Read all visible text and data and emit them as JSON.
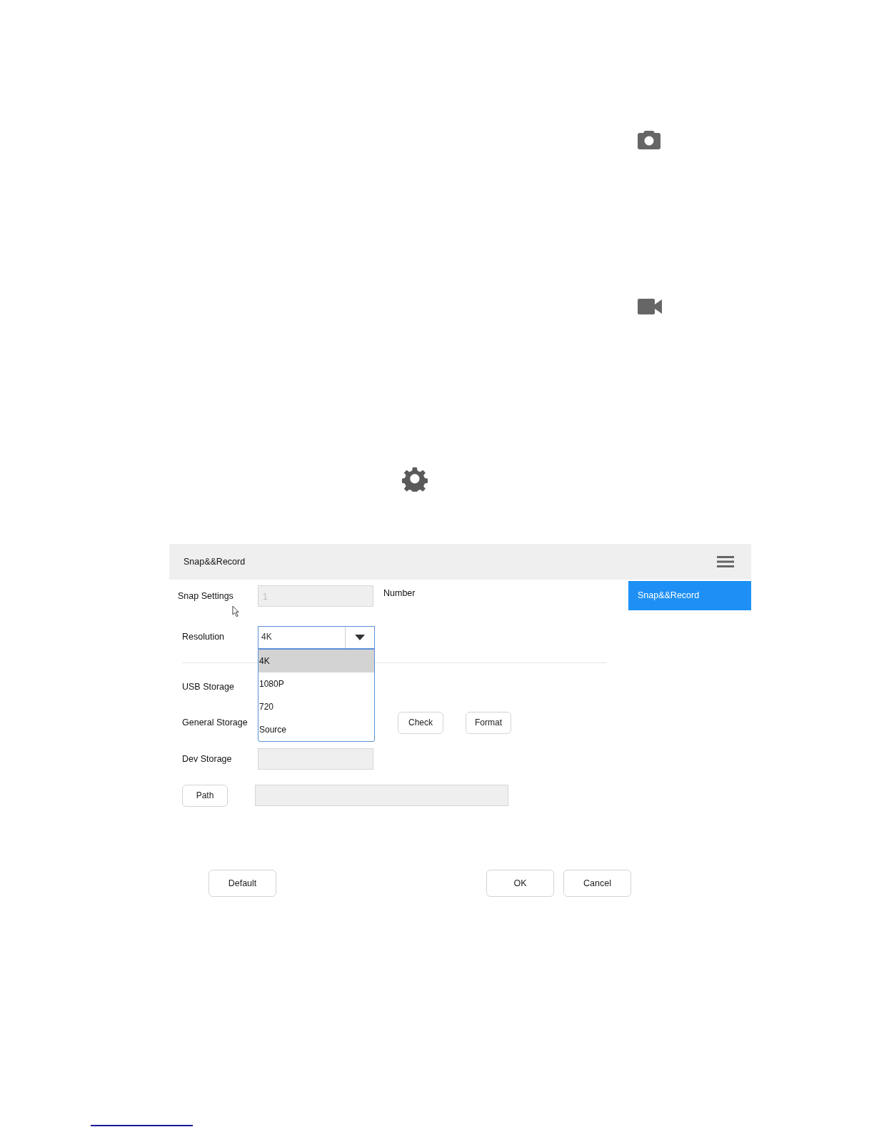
{
  "dialog": {
    "title": "Snap&&Record",
    "menu_items": [
      {
        "label": "Snap&&Record",
        "selected": true
      }
    ],
    "snap_settings": {
      "label": "Snap Settings",
      "value": "1",
      "disabled": true,
      "unit": "Number"
    },
    "resolution": {
      "label": "Resolution",
      "value": "4K",
      "expanded": true,
      "options": [
        {
          "label": "4K",
          "selected": true
        },
        {
          "label": "1080P",
          "selected": false
        },
        {
          "label": "720",
          "selected": false
        },
        {
          "label": "Source",
          "selected": false
        }
      ]
    },
    "usb_storage": {
      "label": "USB Storage"
    },
    "general_storage": {
      "label": "General Storage",
      "buttons": [
        "Check",
        "Format"
      ]
    },
    "dev_storage": {
      "label": "Dev Storage"
    },
    "path": {
      "button": "Path"
    },
    "footer": {
      "left_buttons": [
        "Default"
      ],
      "right_buttons": [
        "OK",
        "Cancel"
      ]
    }
  }
}
